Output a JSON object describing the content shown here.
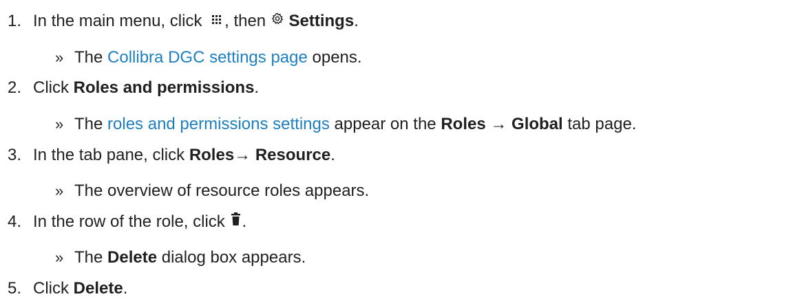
{
  "steps": [
    {
      "number": "1.",
      "text_before": "In the main menu, click ",
      "icon1": "grid-menu-icon",
      "text_mid": ", then ",
      "icon2": "gear-icon",
      "bold": "Settings",
      "text_after": ".",
      "result": {
        "marker": "»",
        "text_before": "The ",
        "link": "Collibra DGC settings page",
        "text_after": " opens."
      }
    },
    {
      "number": "2.",
      "text_before": "Click ",
      "bold": "Roles and permissions",
      "text_after": ".",
      "result": {
        "marker": "»",
        "text_before": "The ",
        "link": "roles and permissions settings",
        "text_mid": " appear on the ",
        "bold1": "Roles",
        "arrow": " → ",
        "bold2": "Global",
        "text_after": " tab page."
      }
    },
    {
      "number": "3.",
      "text_before": "In the tab pane, click ",
      "bold1": "Roles",
      "arrow": "→ ",
      "bold2": "Resource",
      "text_after": ".",
      "result": {
        "marker": "»",
        "text": "The overview of resource roles appears."
      }
    },
    {
      "number": "4.",
      "text_before": "In the row of the role, click ",
      "icon": "trash-icon",
      "text_after": ".",
      "result": {
        "marker": "»",
        "text_before": "The ",
        "bold": "Delete",
        "text_after": " dialog box appears."
      }
    },
    {
      "number": "5.",
      "text_before": "Click ",
      "bold": "Delete",
      "text_after": "."
    }
  ],
  "colors": {
    "text": "#1f1f1f",
    "link": "#1d7fbf"
  }
}
